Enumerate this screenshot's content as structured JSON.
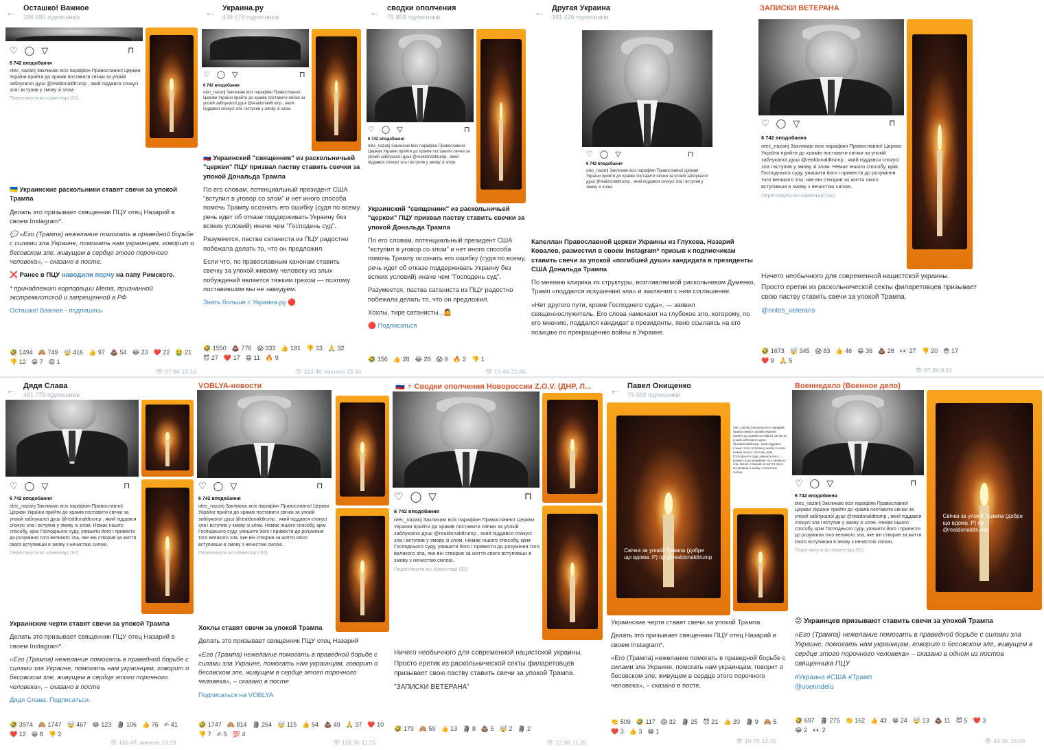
{
  "panels": [
    {
      "channel": "Осташко! Важное",
      "subscribers": "386 695 підписників",
      "likes": "6 742 вподобання",
      "ig_caption": "otec_nazarij Закликаю всіх парафіян Православної Церкви України прийти до храмів поставити свічки за упокій заблукалої душі @realdonaldtrump , який піддався спокусі зла і вступив у змову зі злом.",
      "ig_more": "Переглянути всі коментарі (92)",
      "headline": "🇺🇦 Украинские раскольники ставят свечи за упокой Трампа",
      "body1": "Делать это призывает священник ПЦУ отец Назарий в своем Instagram*.",
      "quote": "💬 «Его (Трампа) нежелание помогать в праведной борьбе с силами зла Украине, помогать нам украинцам, говорит о бесовском зле, живущем в сердце этого порочного человека», – сказано в посте.",
      "body2a": "❌ Ранее в ПЦУ ",
      "body2link": "наводили порчу",
      "body2b": " на папу Римского.",
      "footnote": "* принадлежит корпорации Мета, признанной экстремистской и запрещенной в РФ",
      "sign": "Осташко! Важное - подпишись",
      "reactions": [
        "🤣 1494",
        "🙈 749",
        "🤯 416",
        "👍 97",
        "💩 54",
        "😂 23",
        "❤️ 22",
        "🤮 21",
        "👎 12",
        "😁 7",
        "😄 1"
      ],
      "meta": "👁 97.8K 10:16"
    },
    {
      "channel": "Украина.ру",
      "subscribers": "438 678 підписників",
      "likes": "6 742 вподобання",
      "headline": "🇷🇺 Украинский \"священник\" из раскольничьей \"церкви\" ПЦУ призвал паству ставить свечки за упокой Дональда Трампа",
      "body1": "По его словам, потенциальный президент США \"вступил в уговор со злом\" и нет иного способа помочь Трампу осознать его ошибку (судя по всему, речь идет об отказе поддерживать Украину без всяких условий) иначе чем \"Господень суд\".",
      "body2": "Разумеется, паства сатаниста из ПЦУ радостно побежала делать то, что он предложил.",
      "body3": "Если что, по православным канонам ставить свечку за упокой живому человеку из злых побуждений является тяжким грехом — поэтому поставившим мы не завидуем.",
      "sign": "Знать больше с Украина.ру 🔴",
      "reactions": [
        "🤣 1550",
        "💩 776",
        "😱 333",
        "👍 181",
        "👎 33",
        "🙏 32",
        "😈 27",
        "❤️ 17",
        "😁 11",
        "🔥 9"
      ],
      "meta": "👁 313.4K змінено 19:30"
    },
    {
      "channel": "сводки ополчения",
      "subscribers": "75 858 підписників",
      "likes": "6 742 вподобання",
      "headline": "Украинский \"священник\" из раскольничьей \"церкви\" ПЦУ призвал паству ставить свечки за упокой Дональда Трампа",
      "body1": "По его словам, потенциальный президент США \"вступил в уговор со злом\" и нет иного способа помочь Трампу осознать его ошибку (судя по всему, речь идет об отказе поддерживать Украину без всяких условий) иначе чем \"Господень суд\".",
      "body2": "Разумеется, паства сатаниста из ПЦУ радостно побежала делать то, что он предложил.",
      "body3": "Хохлы, тире сатанисты...🤷",
      "sign": "🔴 Подписаться",
      "reactions": [
        "🤣 156",
        "👍 28",
        "😂 28",
        "😱 9",
        "🔥 2",
        "👎 1"
      ],
      "meta": "👁 19.4K 21:46"
    },
    {
      "channel": "Другая Украина",
      "subscribers": "181 426 підписників",
      "likes": "6 742 вподобання",
      "headline": "Капеллан Православной церкви Украины из Глухова, Назарий Ковалев, разместил в своем Instagram* призыв к подписчикам ставить свечи за упокой «погибшей души» кандидата в президенты США Дональда Трампа",
      "body1": "По мнению клирика из структуры, возглавляемой раскольником Думенко, Трамп «поддался искушению зла» и заключил с ним соглашение.",
      "body2": "«Нет другого пути, кроме Господнего суда», — заявил священнослужитель. Его слова намекают на глубокое зло, которому, по его мнению, поддался кандидат в президенты, явно ссылаясь на его позицию по прекращению войны в Украине."
    },
    {
      "channel": "ЗАПИСКИ ВЕТЕРАНА",
      "likes": "6 742 вподобання",
      "ig_caption": "otec_nazarij Закликаю всіх парафіян Православної Церкви України прийти до храмів поставити свічки за упокій заблукалої душі @realdonaldtrump , який піддався спокусі зла і вступив у змову зі злом. Немає іншого способу, крім Господнього суду, уяишити його і привести до розуміння того великого зла, яке він створив за життя свого вступивши в змову з нечистою силою.",
      "ig_more": "Переглянути всі коментарі (92)",
      "body1": "Ничего необычного для современной нацистской украины.",
      "body2": "Просто еретик из раскольнической секты филаретовцев призывает свою паству ставить свечи за упокой Трампа.",
      "sign": "@notes_veterans",
      "reactions": [
        "🤣 1673",
        "🤯 345",
        "😱 83",
        "👍 46",
        "😁 36",
        "💩 28",
        "👀 27",
        "👎 20",
        "😎 17",
        "❤️ 8",
        "🙏 5"
      ],
      "meta": "👁 97.8K 9:51"
    },
    {
      "channel": "Дядя Слава",
      "subscribers": "491 775 підписників",
      "likes": "6 742 вподобання",
      "headline": "Украинские черти ставят свечи за упокой Трампа",
      "body1": "Делать это призывает священник ПЦУ отец Назарий в своем Instagram*.",
      "quote": "«Его (Трампа) нежелание помогать в праведной борьбе с силами зла Украине, помогать нам украинцам, говорит о бесовском зле, живущем в сердце этого порочного человека», – сказано в посте",
      "sign": "Дядя Слава. Подписаться.",
      "reactions": [
        "🤣 3974",
        "🙈 1747",
        "🤯 467",
        "😂 123",
        "🗿 106",
        "👍 76",
        "✍ 41",
        "❤️ 12",
        "😁 8",
        "👎 2"
      ],
      "meta": "👁 166.4K змінено 10:39"
    },
    {
      "channel": "VOBLYA-новости",
      "likes": "6 742 вподобання",
      "headline": "Хохлы ставят свечи за упокой Трампа",
      "body1": "Делать это призывает священник ПЦУ отец Назарий",
      "quote": "«Его (Трампа) нежелание помогать в праведной борьбе с силами зла Украине, помогать нам украинцам, говорит о бесовском зле, живущем в сердце этого порочного человека», – сказано в посте",
      "sign": "Подписаться на VOBLYA",
      "reactions": [
        "🤣 1747",
        "🙈 814",
        "🗿 264",
        "🤯 115",
        "👍 54",
        "💩 49",
        "🙏 37",
        "❤️ 10",
        "👎 7",
        "✍ 5",
        "💯 4"
      ],
      "meta": "👁 118.3K 11:15"
    },
    {
      "channel": "🇷🇺 ⚡ Сводки ополчения Новороссии Z.O.V. (ДНР, Л...",
      "likes": "6 742 вподобання",
      "ig_caption": "otec_nazarij Закликаю всіх парафіян Православної Церкви України прийти до храмів поставити свічки за упокій заблукалої душі @realdonaldtrump , який піддався спокусі зла і вступив у змову зі злом. Немає іншого способу, крім Господнього суду, уяишити його і привести до розуміння того великого зла, яке він створив за життя свого вступивши в змову з нечистою силою.",
      "ig_more": "Переглянути всі коментарі (92)",
      "body1": "Ничего необычного для современной нацистской украины.",
      "body2": "Просто еретик из раскольнической секты филаретовцев призывает свою паству ставить свечи за упокой Трампа.",
      "sign": "\"ЗАПИСКИ ВЕТЕРАНА\"",
      "reactions": [
        "🤣 179",
        "🙈 59",
        "👍 13",
        "🗿 8",
        "💩 5",
        "🤯 2",
        "🗿 2"
      ],
      "meta": "👁 22.9K 11:39"
    },
    {
      "channel": "Павел Онищенко",
      "subscribers": "79 069 підписників",
      "story_caption": "Свічка за упокій Трампа (добре що вдома :Р) rip @realdonaldtrump",
      "headline": "Украинские черти ставят свечи за упокой Трампа",
      "body1": "Делать это призывает священник ПЦУ отец Назарий в своем Instagram*.",
      "quote": "«Его (Трампа) нежелание помогать в праведной борьбе с силами зла Украине, помогать нам украинцам, говорит о бесовском зле, живущем в сердце этого порочного человека», – сказано в посте.",
      "reactions": [
        "👏 509",
        "🤣 117",
        "😱 32",
        "🗿 25",
        "😈 21",
        "👍 20",
        "🗿 9",
        "🙈 5",
        "❤️ 3",
        "👍 3",
        "😁 1"
      ],
      "meta": "👁 16.7K 12:45"
    },
    {
      "channel": "Военнедело (Военное дело)",
      "likes": "6 742 вподобання",
      "story_caption": "Свічка за упокій Трампа (добре що вдома :Р) rip @realdonaldtrump",
      "headline": "😡 Украинцев призывают ставить свечи за упокой Трампа",
      "quote": "«Его (Трампа) нежелание помогать в праведной борьбе с силами зла Украине, помогать нам украинцам, говорит о бесовском зле, живущем в сердце этого порочного человека» – сказано в одном из постов священника ПЦУ",
      "tags": "#Украина #США #Трамп",
      "sign": "@voenndelo",
      "reactions": [
        "🤣 697",
        "🗿 275",
        "👏 162",
        "👍 43",
        "😁 24",
        "🤯 13",
        "💩 11",
        "😈 5",
        "❤️ 3",
        "😂 2",
        "👀 2"
      ],
      "meta": "👁 44.3K 15:00"
    }
  ],
  "story_caption_default": "Свічка за упокій Трампа (добре що вдома :Р) rip @realdonaldtrump"
}
